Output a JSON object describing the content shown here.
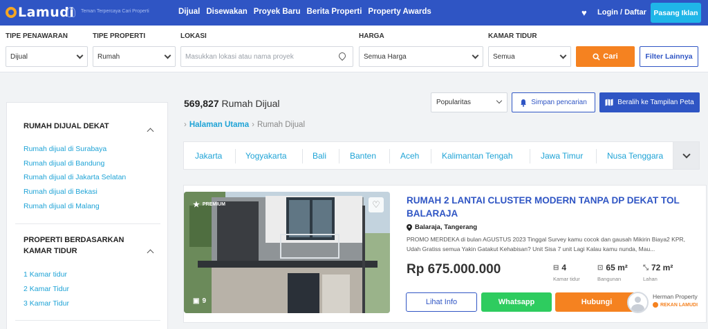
{
  "header": {
    "logo_text": "Lamudi",
    "tagline": "Teman Terpercaya Cari Properti",
    "nav": [
      "Dijual",
      "Disewakan",
      "Proyek Baru",
      "Berita Properti",
      "Property Awards"
    ],
    "login": "Login / Daftar",
    "post_ad": "Pasang Iklan"
  },
  "search": {
    "offer_type": {
      "label": "TIPE PENAWARAN",
      "value": "Dijual"
    },
    "property_type": {
      "label": "TIPE PROPERTI",
      "value": "Rumah"
    },
    "location": {
      "label": "LOKASI",
      "placeholder": "Masukkan lokasi atau nama proyek"
    },
    "price": {
      "label": "HARGA",
      "value": "Semua Harga"
    },
    "bedrooms": {
      "label": "KAMAR TIDUR",
      "value": "Semua"
    },
    "search_button": "Cari",
    "more_filters": "Filter Lainnya"
  },
  "sidebar": {
    "nearby_heading": "RUMAH DIJUAL DEKAT",
    "nearby_links": [
      "Rumah dijual di Surabaya",
      "Rumah dijual di Bandung",
      "Rumah dijual di Jakarta Selatan",
      "Rumah dijual di Bekasi",
      "Rumah dijual di Malang"
    ],
    "bedroom_heading": "PROPERTI BERDASARKAN KAMAR TIDUR",
    "bedroom_links": [
      "1 Kamar tidur",
      "2 Kamar Tidur",
      "3 Kamar Tidur"
    ]
  },
  "results": {
    "count": "569,827",
    "count_label": "Rumah Dijual",
    "sort": "Popularitas",
    "save_search": "Simpan pencarian",
    "map_view": "Beralih ke Tampilan Peta"
  },
  "breadcrumb": {
    "home": "Halaman Utama",
    "current": "Rumah Dijual"
  },
  "cities": [
    "Jakarta",
    "Yogyakarta",
    "Bali",
    "Banten",
    "Aceh",
    "Kalimantan Tengah",
    "Jawa Timur",
    "Nusa Tenggara"
  ],
  "listing": {
    "badge": "PREMIUM",
    "photo_count": "9",
    "title": "RUMAH 2 LANTAI CLUSTER MODERN TANPA DP DEKAT TOL BALARAJA",
    "location": "Balaraja, Tangerang",
    "description": "PROMO MERDEKA di bulan AGUSTUS 2023 Tinggal Survey kamu cocok dan gausah Mikirin Biaya2 KPR, Udah Gratiss semua Yakin Gatakut Kehabisan? Unit Sisa 7 unit Lagi Kalau kamu nunda, Mau...",
    "price": "Rp 675.000.000",
    "bedrooms": {
      "value": "4",
      "label": "Kamar tidur"
    },
    "building": {
      "value": "65 m²",
      "label": "Bangunan"
    },
    "land": {
      "value": "72 m²",
      "label": "Lahan"
    },
    "info_button": "Lihat Info",
    "whatsapp_button": "Whatsapp",
    "call_button": "Hubungi",
    "agent_name": "Herman Property",
    "agent_tag": "REKAN LAMUDI"
  },
  "colors": {
    "primary": "#2f55c4",
    "accent": "#f58220",
    "link": "#1ea3d6",
    "whatsapp": "#2ecc5f",
    "cta": "#1fb6e8"
  }
}
